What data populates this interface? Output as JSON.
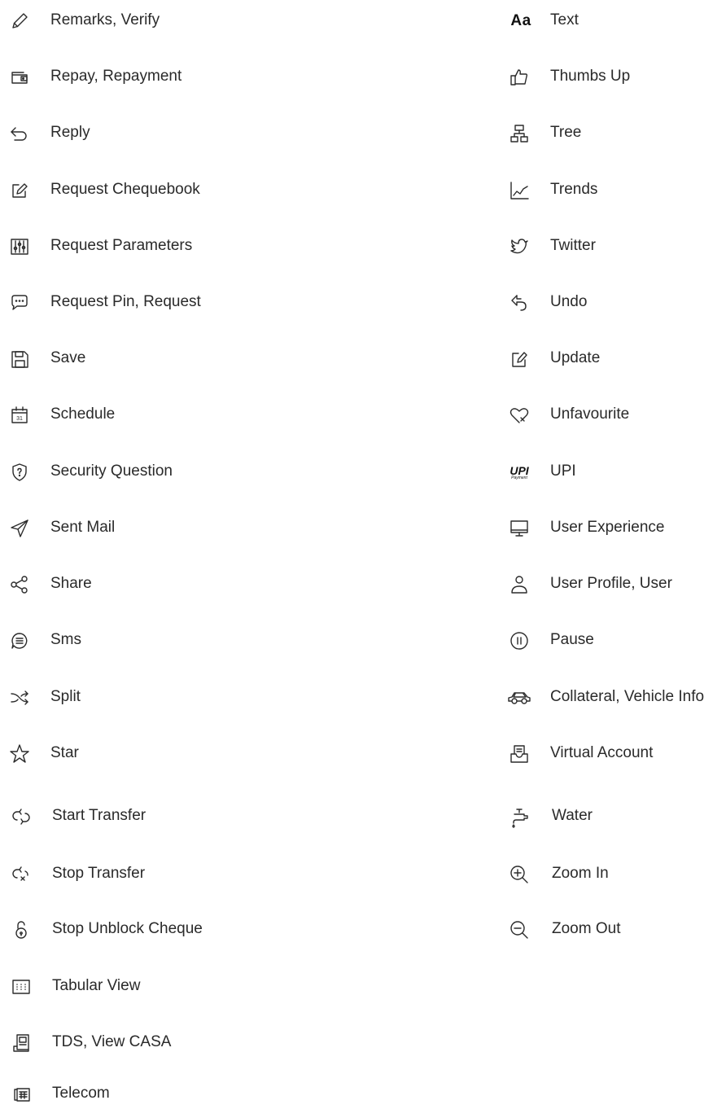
{
  "left_items": [
    {
      "label": "Remarks, Verify",
      "icon": "pencil-icon"
    },
    {
      "label": "Repay, Repayment",
      "icon": "wallet-icon"
    },
    {
      "label": "Reply",
      "icon": "reply-arrow-icon"
    },
    {
      "label": "Request Chequebook",
      "icon": "edit-box-icon"
    },
    {
      "label": "Request Parameters",
      "icon": "sliders-icon"
    },
    {
      "label": "Request Pin, Request",
      "icon": "chat-bubble-icon"
    },
    {
      "label": "Save",
      "icon": "floppy-disk-icon"
    },
    {
      "label": "Schedule",
      "icon": "calendar-icon"
    },
    {
      "label": "Security Question",
      "icon": "shield-question-icon"
    },
    {
      "label": "Sent Mail",
      "icon": "paper-plane-icon"
    },
    {
      "label": "Share",
      "icon": "share-icon"
    },
    {
      "label": "Sms",
      "icon": "message-circle-icon"
    },
    {
      "label": "Split",
      "icon": "shuffle-icon"
    },
    {
      "label": "Star",
      "icon": "star-icon"
    },
    {
      "label": "Start Transfer",
      "icon": "transfer-icon"
    },
    {
      "label": "Stop Transfer",
      "icon": "stop-transfer-icon"
    },
    {
      "label": "Stop Unblock Cheque",
      "icon": "unlock-icon"
    },
    {
      "label": "Tabular View",
      "icon": "grid-table-icon"
    },
    {
      "label": "TDS, View CASA",
      "icon": "document-stack-icon"
    },
    {
      "label": "Telecom",
      "icon": "telephone-icon"
    }
  ],
  "right_items": [
    {
      "label": "Text",
      "icon": "text-aa-icon",
      "icon_text": "Aa"
    },
    {
      "label": "Thumbs Up",
      "icon": "thumbs-up-icon"
    },
    {
      "label": "Tree",
      "icon": "tree-hierarchy-icon"
    },
    {
      "label": "Trends",
      "icon": "trend-chart-icon"
    },
    {
      "label": "Twitter",
      "icon": "twitter-bird-icon"
    },
    {
      "label": "Undo",
      "icon": "undo-icon"
    },
    {
      "label": "Update",
      "icon": "update-edit-icon"
    },
    {
      "label": "Unfavourite",
      "icon": "heart-x-icon"
    },
    {
      "label": "UPI",
      "icon": "upi-logo-icon",
      "icon_text": "UPI",
      "icon_subtext": "Payment"
    },
    {
      "label": "User Experience",
      "icon": "monitor-icon"
    },
    {
      "label": "User Profile, User",
      "icon": "user-icon"
    },
    {
      "label": "Pause",
      "icon": "pause-circle-icon"
    },
    {
      "label": "Collateral, Vehicle Info",
      "icon": "car-icon"
    },
    {
      "label": "Virtual Account",
      "icon": "inbox-doc-icon"
    },
    {
      "label": "Water",
      "icon": "water-tap-icon"
    },
    {
      "label": "Zoom In",
      "icon": "zoom-in-icon"
    },
    {
      "label": "Zoom Out",
      "icon": "zoom-out-icon"
    }
  ]
}
